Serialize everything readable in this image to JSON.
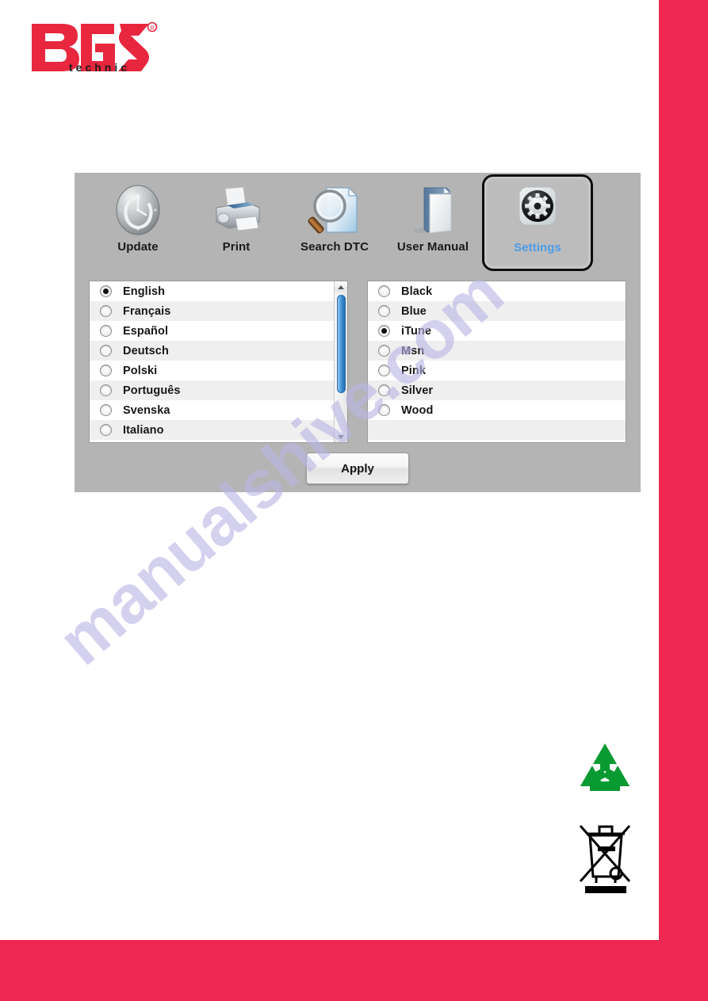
{
  "page": {
    "brand_logo_text": "BGS",
    "brand_logo_subtext": "technic",
    "brand_red": "#ee2852",
    "watermark": "manualshive.com"
  },
  "app": {
    "background_color": "#b4b4b4",
    "toolbar": {
      "items": [
        {
          "label": "Update",
          "icon": "clock-history-icon",
          "active": false
        },
        {
          "label": "Print",
          "icon": "printer-icon",
          "active": false
        },
        {
          "label": "Search DTC",
          "icon": "magnifier-document-icon",
          "active": false
        },
        {
          "label": "User Manual",
          "icon": "manual-book-icon",
          "active": false
        },
        {
          "label": "Settings",
          "icon": "gear-icon",
          "active": true
        }
      ],
      "active_label_color": "#4c9ce8"
    },
    "language_list": {
      "name": "language-list",
      "has_scrollbar": true,
      "scroll_up_icon": "caret-up-icon",
      "scroll_down_icon": "caret-down-icon",
      "items": [
        {
          "label": "English",
          "selected": true
        },
        {
          "label": "Français",
          "selected": false
        },
        {
          "label": "Español",
          "selected": false
        },
        {
          "label": "Deutsch",
          "selected": false
        },
        {
          "label": "Polski",
          "selected": false
        },
        {
          "label": "Português",
          "selected": false
        },
        {
          "label": "Svenska",
          "selected": false
        },
        {
          "label": "Italiano",
          "selected": false
        }
      ]
    },
    "theme_list": {
      "name": "theme-list",
      "has_scrollbar": false,
      "items": [
        {
          "label": "Black",
          "selected": false
        },
        {
          "label": "Blue",
          "selected": false
        },
        {
          "label": "iTune",
          "selected": true
        },
        {
          "label": "Msn",
          "selected": false
        },
        {
          "label": "Pink",
          "selected": false
        },
        {
          "label": "Silver",
          "selected": false
        },
        {
          "label": "Wood",
          "selected": false
        }
      ]
    },
    "apply_button": {
      "label": "Apply"
    }
  },
  "footer_symbols": [
    {
      "name": "recycle-symbol",
      "color": "#0a9a32"
    },
    {
      "name": "weee-crossed-bin-symbol",
      "color": "#000000"
    }
  ]
}
